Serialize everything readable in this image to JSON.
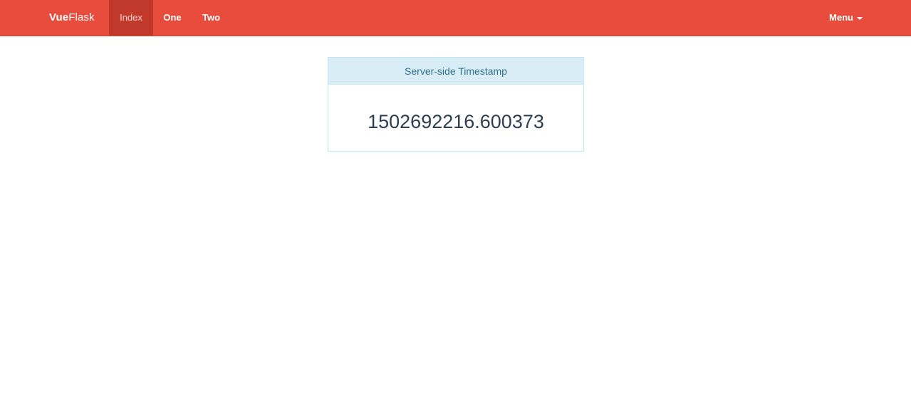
{
  "navbar": {
    "brand_bold": "Vue",
    "brand_rest": "Flask",
    "items": [
      {
        "label": "Index",
        "active": true
      },
      {
        "label": "One",
        "active": false
      },
      {
        "label": "Two",
        "active": false
      }
    ],
    "menu_label": "Menu",
    "color": "#e74c3c",
    "active_color": "#c0392b"
  },
  "panel": {
    "heading": "Server-side Timestamp",
    "value": "1502692216.600373",
    "heading_bg": "#d9edf7",
    "border_color": "#bce8f1"
  },
  "icons": {
    "menu_caret": "caret-down-icon"
  }
}
